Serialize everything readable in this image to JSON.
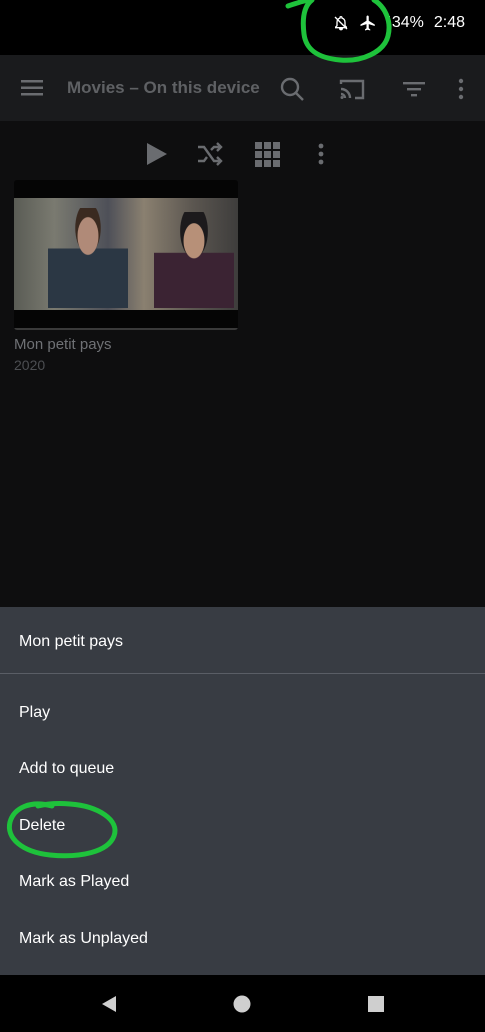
{
  "status_bar": {
    "battery": "34%",
    "time": "2:48",
    "icons": [
      "notifications-off-icon",
      "airplane-mode-icon",
      "battery-icon"
    ]
  },
  "app_bar": {
    "title": "Movies – On this device",
    "icons": [
      "menu-icon",
      "search-icon",
      "cast-icon",
      "filter-icon",
      "more-vert-icon"
    ]
  },
  "toolbar": {
    "icons": [
      "play-icon",
      "shuffle-icon",
      "grid-view-icon",
      "more-vert-icon"
    ]
  },
  "movie": {
    "title": "Mon petit pays",
    "year": "2020"
  },
  "context_menu": {
    "title": "Mon petit pays",
    "items": [
      {
        "label": "Play"
      },
      {
        "label": "Add to queue"
      },
      {
        "label": "Delete"
      },
      {
        "label": "Mark as Played"
      },
      {
        "label": "Mark as Unplayed"
      }
    ]
  },
  "nav_bar": {
    "icons": [
      "back-icon",
      "home-icon",
      "recents-icon"
    ]
  },
  "colors": {
    "annotation": "#1ec23b",
    "sheet_bg": "#383c43",
    "app_bar_bg": "#1a1b1d"
  }
}
